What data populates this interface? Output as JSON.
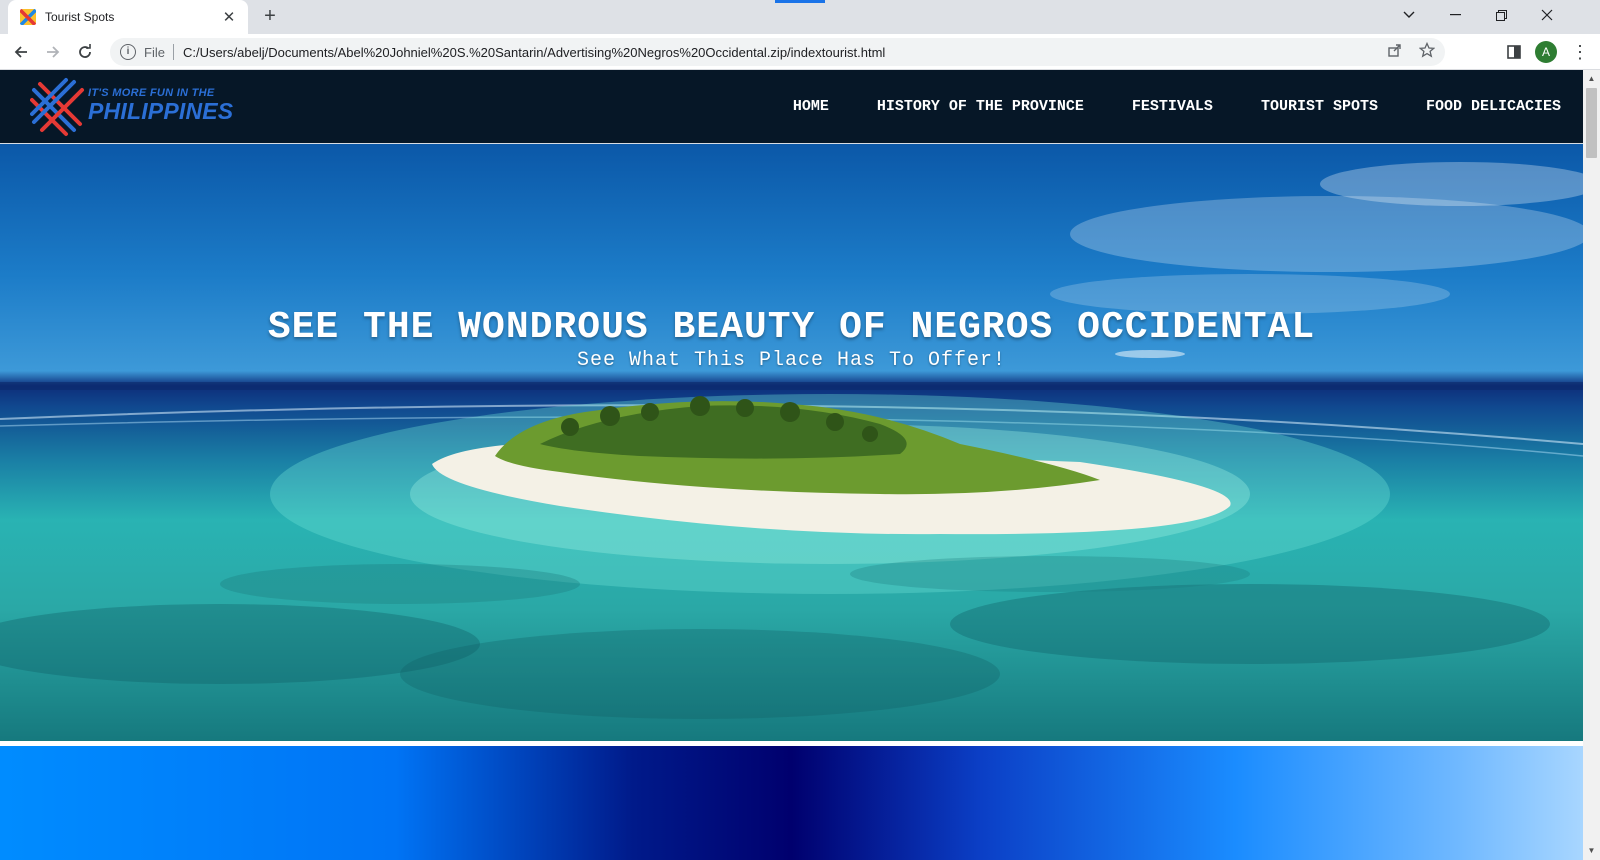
{
  "browser": {
    "tab": {
      "title": "Tourist Spots"
    },
    "scheme_label": "File",
    "url": "C:/Users/abelj/Documents/Abel%20Johniel%20S.%20Santarin/Advertising%20Negros%20Occidental.zip/indextourist.html",
    "profile_initial": "A",
    "icons": [
      "back-icon",
      "forward-icon",
      "reload-icon",
      "info-icon",
      "share-icon",
      "star-icon",
      "side-panel-icon",
      "menu-icon",
      "minimize-icon",
      "restore-icon",
      "close-icon",
      "tab-search-icon",
      "new-tab-icon"
    ]
  },
  "site": {
    "logo": {
      "tagline": "IT'S MORE FUN IN THE",
      "name": "PHILIPPINES"
    },
    "nav": [
      "HOME",
      "HISTORY OF THE PROVINCE",
      "FESTIVALS",
      "TOURIST SPOTS",
      "FOOD DELICACIES"
    ],
    "hero": {
      "title": "SEE THE WONDROUS BEAUTY OF NEGROS OCCIDENTAL",
      "subtitle": "See What This Place Has To Offer!"
    }
  },
  "colors": {
    "header_bg": "#061727",
    "accent_blue": "#1a73e8",
    "logo_blue": "#2b6fd6",
    "logo_red": "#e53935",
    "band_dark": "#00006e",
    "band_light": "#008cff"
  }
}
